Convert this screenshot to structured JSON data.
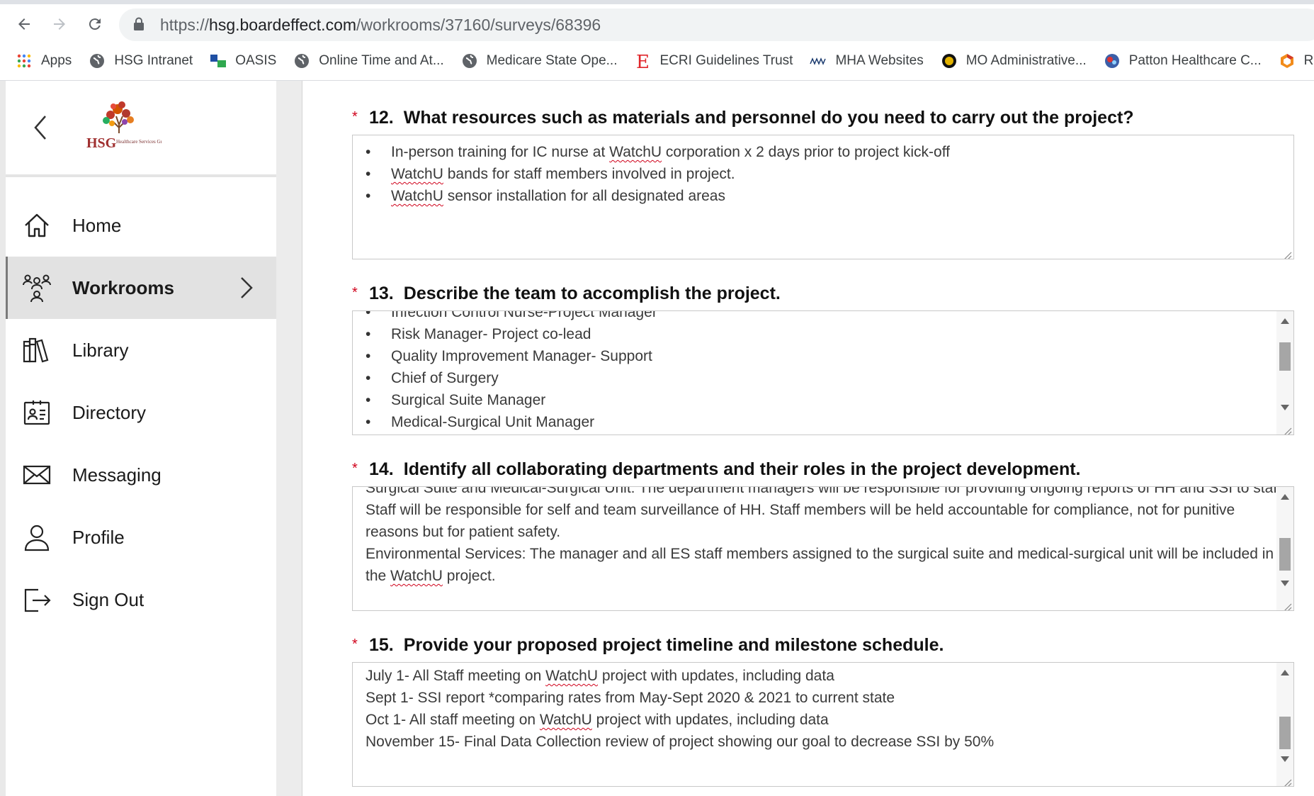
{
  "browser": {
    "url_scheme": "https://",
    "url_host": "hsg.boardeffect.com",
    "url_path": "/workrooms/37160/surveys/68396",
    "bookmarks": [
      {
        "label": "Apps",
        "icon": "apps-grid-icon"
      },
      {
        "label": "HSG Intranet",
        "icon": "globe-icon"
      },
      {
        "label": "OASIS",
        "icon": "oasis-icon"
      },
      {
        "label": "Online Time and At...",
        "icon": "globe-icon"
      },
      {
        "label": "Medicare State Ope...",
        "icon": "globe-icon"
      },
      {
        "label": "ECRI Guidelines Trust",
        "icon": "ecri-icon"
      },
      {
        "label": "MHA Websites",
        "icon": "mha-icon"
      },
      {
        "label": "MO Administrative...",
        "icon": "mo-seal-icon"
      },
      {
        "label": "Patton Healthcare C...",
        "icon": "patton-icon"
      },
      {
        "label": "Rural",
        "icon": "rural-icon"
      }
    ]
  },
  "sidebar": {
    "logo_text": "HSG",
    "logo_subtext": "Healthcare Services Group",
    "items": [
      {
        "label": "Home",
        "icon": "home-icon",
        "active": false
      },
      {
        "label": "Workrooms",
        "icon": "workrooms-icon",
        "active": true
      },
      {
        "label": "Library",
        "icon": "library-icon",
        "active": false
      },
      {
        "label": "Directory",
        "icon": "directory-icon",
        "active": false
      },
      {
        "label": "Messaging",
        "icon": "envelope-icon",
        "active": false
      },
      {
        "label": "Profile",
        "icon": "user-icon",
        "active": false
      },
      {
        "label": "Sign Out",
        "icon": "sign-out-icon",
        "active": false
      }
    ]
  },
  "questions": [
    {
      "required_mark": "*",
      "number": "12.",
      "title": "What resources such as materials and personnel do you need to carry out the project?",
      "answer_items": [
        {
          "pre": "In-person training for IC nurse at ",
          "spell": "WatchU",
          "post": " corporation x 2 days prior to project kick-off"
        },
        {
          "pre": "",
          "spell": "WatchU",
          "post": " bands for staff members involved in project."
        },
        {
          "pre": "",
          "spell": "WatchU",
          "post": " sensor installation for all designated areas"
        }
      ]
    },
    {
      "required_mark": "*",
      "number": "13.",
      "title": "Describe the team to accomplish the project.",
      "answer_items": [
        "Infection Control Nurse-Project Manager",
        "Risk Manager- Project co-lead",
        "Quality Improvement Manager- Support",
        "Chief of Surgery",
        "Surgical Suite Manager",
        "Medical-Surgical Unit Manager"
      ]
    },
    {
      "required_mark": "*",
      "number": "14.",
      "title": "Identify all collaborating departments and their roles in the project development.",
      "answer_lines": [
        "Surgical Suite and Medical-Surgical Unit:  The department managers will be responsible for providing ongoing reports of HH and SSI to staff.",
        "Staff will be responsible for self and team surveillance of HH.  Staff members will be held accountable for compliance, not for punitive",
        "reasons but for patient safety.",
        "Environmental Services:  The manager and all ES staff members assigned to the surgical suite and medical-surgical unit will be included in"
      ],
      "last_line": {
        "pre": "the ",
        "spell": "WatchU",
        "post": " project."
      }
    },
    {
      "required_mark": "*",
      "number": "15.",
      "title": "Provide your proposed project timeline and milestone schedule.",
      "answer_lines": [
        {
          "pre": "July 1- All Staff meeting on ",
          "spell": "WatchU",
          "post": " project with updates, including data"
        },
        {
          "pre": "Sept 1- SSI report *comparing rates from May-Sept 2020 & 2021 to current state",
          "spell": "",
          "post": ""
        },
        {
          "pre": "Oct 1- All staff meeting on ",
          "spell": "WatchU",
          "post": " project with updates, including data"
        },
        {
          "pre": "November 15- Final Data Collection review of project showing our goal to decrease SSI by 50%",
          "spell": "",
          "post": ""
        }
      ]
    }
  ]
}
